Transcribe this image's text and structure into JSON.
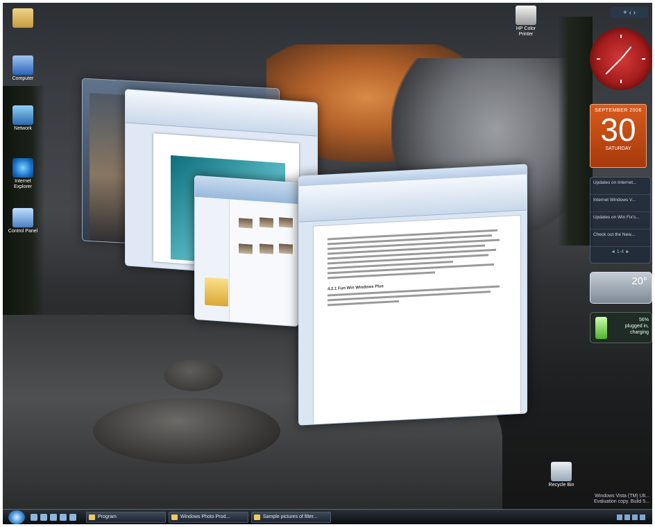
{
  "desktop": {
    "icons": [
      {
        "label": ""
      },
      {
        "label": "Computer"
      },
      {
        "label": "Network"
      },
      {
        "label": "Internet Explorer"
      },
      {
        "label": "Control Panel"
      },
      {
        "label": "HP Color Printer"
      },
      {
        "label": "Recycle Bin"
      }
    ]
  },
  "sidebar": {
    "top_controls": "+ ‹ ›",
    "calendar": {
      "month": "SEPTEMBER 2006",
      "day": "30",
      "weekday": "SATURDAY"
    },
    "feeds": {
      "items": [
        "Updates on Internet...",
        "Internet Windows V...",
        "Updates on Win Fix's...",
        "Check out the New..."
      ],
      "nav": "◄ 1-4 ►"
    },
    "weather": {
      "temp": "20°"
    },
    "battery": {
      "percent": "56%",
      "status": "plugged in, charging"
    }
  },
  "windows": {
    "word_doc": {
      "heading": "4.2.1 Fun Win Windows Plus"
    }
  },
  "taskbar": {
    "buttons": [
      "Program",
      "Windows Photo Prod...",
      "Sample pictures of filter..."
    ]
  },
  "watermark": {
    "line1": "Windows Vista (TM) Ult...",
    "line2": "Evaluation copy. Build 5..."
  }
}
